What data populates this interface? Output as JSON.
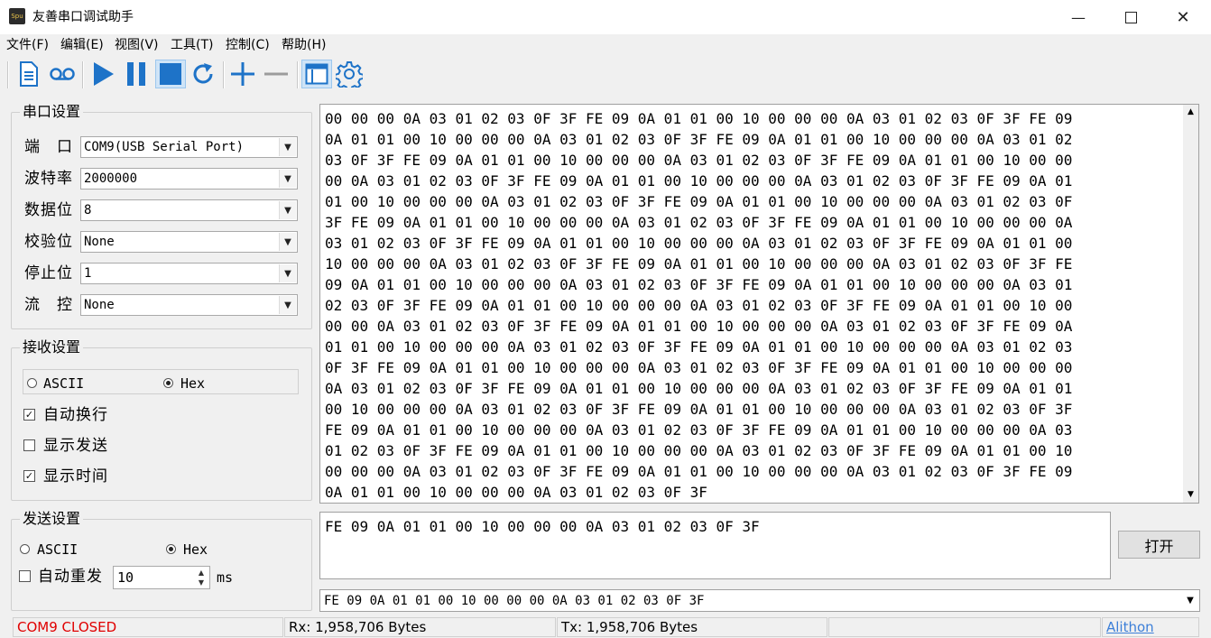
{
  "window": {
    "title": "友善串口调试助手",
    "icon_text": "Spu"
  },
  "menu": [
    {
      "label": "文件(F)"
    },
    {
      "label": "编辑(E)"
    },
    {
      "label": "视图(V)"
    },
    {
      "label": "工具(T)"
    },
    {
      "label": "控制(C)"
    },
    {
      "label": "帮助(H)"
    }
  ],
  "toolbar_icons": [
    "document-icon",
    "record-icon",
    "play-icon",
    "pause-icon",
    "stop-icon",
    "refresh-icon",
    "add-icon",
    "remove-icon",
    "window-icon",
    "gear-icon"
  ],
  "serial": {
    "title": "串口设置",
    "port_label": "端　口",
    "port_value": "COM9(USB Serial Port)",
    "baud_label": "波特率",
    "baud_value": "2000000",
    "databits_label": "数据位",
    "databits_value": "8",
    "parity_label": "校验位",
    "parity_value": "None",
    "stopbits_label": "停止位",
    "stopbits_value": "1",
    "flow_label": "流　控",
    "flow_value": "None"
  },
  "receive": {
    "title": "接收设置",
    "ascii_label": "ASCII",
    "hex_label": "Hex",
    "mode": "Hex",
    "autowrap_label": "自动换行",
    "autowrap": true,
    "showsend_label": "显示发送",
    "showsend": false,
    "showtime_label": "显示时间",
    "showtime": true
  },
  "send": {
    "title": "发送设置",
    "ascii_label": "ASCII",
    "hex_label": "Hex",
    "mode": "Hex",
    "autorepeat_label": "自动重发",
    "autorepeat": false,
    "interval_value": "10",
    "interval_unit": "ms"
  },
  "rx_lines": [
    "00 00 00 0A 03 01 02 03 0F 3F FE 09 0A 01 01 00 10 00 00 00 0A 03 01 02 03 0F 3F FE 09",
    "0A 01 01 00 10 00 00 00 0A 03 01 02 03 0F 3F FE 09 0A 01 01 00 10 00 00 00 0A 03 01 02",
    "03 0F 3F FE 09 0A 01 01 00 10 00 00 00 0A 03 01 02 03 0F 3F FE 09 0A 01 01 00 10 00 00",
    "00 0A 03 01 02 03 0F 3F FE 09 0A 01 01 00 10 00 00 00 0A 03 01 02 03 0F 3F FE 09 0A 01",
    "01 00 10 00 00 00 0A 03 01 02 03 0F 3F FE 09 0A 01 01 00 10 00 00 00 0A 03 01 02 03 0F",
    "3F FE 09 0A 01 01 00 10 00 00 00 0A 03 01 02 03 0F 3F FE 09 0A 01 01 00 10 00 00 00 0A",
    "03 01 02 03 0F 3F FE 09 0A 01 01 00 10 00 00 00 0A 03 01 02 03 0F 3F FE 09 0A 01 01 00",
    "10 00 00 00 0A 03 01 02 03 0F 3F FE 09 0A 01 01 00 10 00 00 00 0A 03 01 02 03 0F 3F FE",
    "09 0A 01 01 00 10 00 00 00 0A 03 01 02 03 0F 3F FE 09 0A 01 01 00 10 00 00 00 0A 03 01",
    "02 03 0F 3F FE 09 0A 01 01 00 10 00 00 00 0A 03 01 02 03 0F 3F FE 09 0A 01 01 00 10 00",
    "00 00 0A 03 01 02 03 0F 3F FE 09 0A 01 01 00 10 00 00 00 0A 03 01 02 03 0F 3F FE 09 0A",
    "01 01 00 10 00 00 00 0A 03 01 02 03 0F 3F FE 09 0A 01 01 00 10 00 00 00 0A 03 01 02 03",
    "0F 3F FE 09 0A 01 01 00 10 00 00 00 0A 03 01 02 03 0F 3F FE 09 0A 01 01 00 10 00 00 00",
    "0A 03 01 02 03 0F 3F FE 09 0A 01 01 00 10 00 00 00 0A 03 01 02 03 0F 3F FE 09 0A 01 01",
    "00 10 00 00 00 0A 03 01 02 03 0F 3F FE 09 0A 01 01 00 10 00 00 00 0A 03 01 02 03 0F 3F",
    "FE 09 0A 01 01 00 10 00 00 00 0A 03 01 02 03 0F 3F FE 09 0A 01 01 00 10 00 00 00 0A 03",
    "01 02 03 0F 3F FE 09 0A 01 01 00 10 00 00 00 0A 03 01 02 03 0F 3F FE 09 0A 01 01 00 10",
    "00 00 00 0A 03 01 02 03 0F 3F FE 09 0A 01 01 00 10 00 00 00 0A 03 01 02 03 0F 3F FE 09",
    "0A 01 01 00 10 00 00 00 0A 03 01 02 03 0F 3F"
  ],
  "tx_text": "FE 09 0A 01 01 00 10 00 00 00 0A 03 01 02 03 0F 3F",
  "open_button": "打开",
  "history_value": "FE 09 0A 01 01 00 10 00 00 00 0A 03 01 02 03 0F 3F",
  "statusbar": {
    "port_status": "COM9 CLOSED",
    "rx": "Rx: 1,958,706 Bytes",
    "tx": "Tx: 1,958,706 Bytes",
    "link": "Alithon"
  },
  "colors": {
    "status_closed": "#e00000",
    "link": "#3c7fd8",
    "toolbar_blue": "#1e73c8"
  }
}
